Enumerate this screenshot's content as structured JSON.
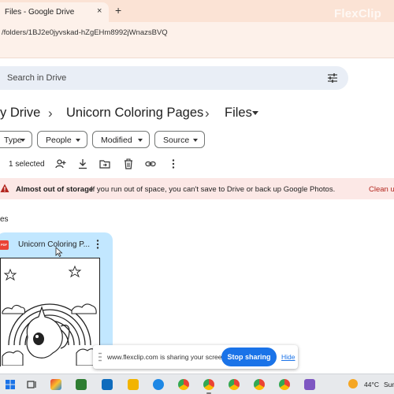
{
  "browser": {
    "tab_title": "Files - Google Drive",
    "tab_close": "×",
    "new_tab": "+",
    "watermark": "FlexClip",
    "url": "/folders/1BJ2e0jyvskad-hZgEHm8992jWnazsBVQ"
  },
  "drive": {
    "search_placeholder": "Search in Drive",
    "breadcrumb": [
      "y Drive",
      "Unicorn Coloring Pages",
      "Files"
    ],
    "breadcrumb_sep": "›",
    "filters": [
      "Type",
      "People",
      "Modified",
      "Source"
    ],
    "selection_text": "1 selected",
    "banner": {
      "title": "Almost out of storage",
      "message": "If you run out of space, you can't save to Drive or back up Google Photos.",
      "link": "Clean u"
    },
    "section_label": "es",
    "file": {
      "type_label": "PDF",
      "name": "Unicorn Coloring P..."
    }
  },
  "share_bar": {
    "message": "www.flexclip.com is sharing your screen.",
    "stop_label": "Stop sharing",
    "hide_label": "Hide"
  },
  "taskbar": {
    "temperature": "44°C",
    "condition": "Sun"
  },
  "colors": {
    "accent": "#1a73e8",
    "card_bg": "#c2e7ff",
    "banner_bg": "#fce8e6",
    "banner_link": "#b3261e",
    "search_bg": "#e9eef6"
  }
}
